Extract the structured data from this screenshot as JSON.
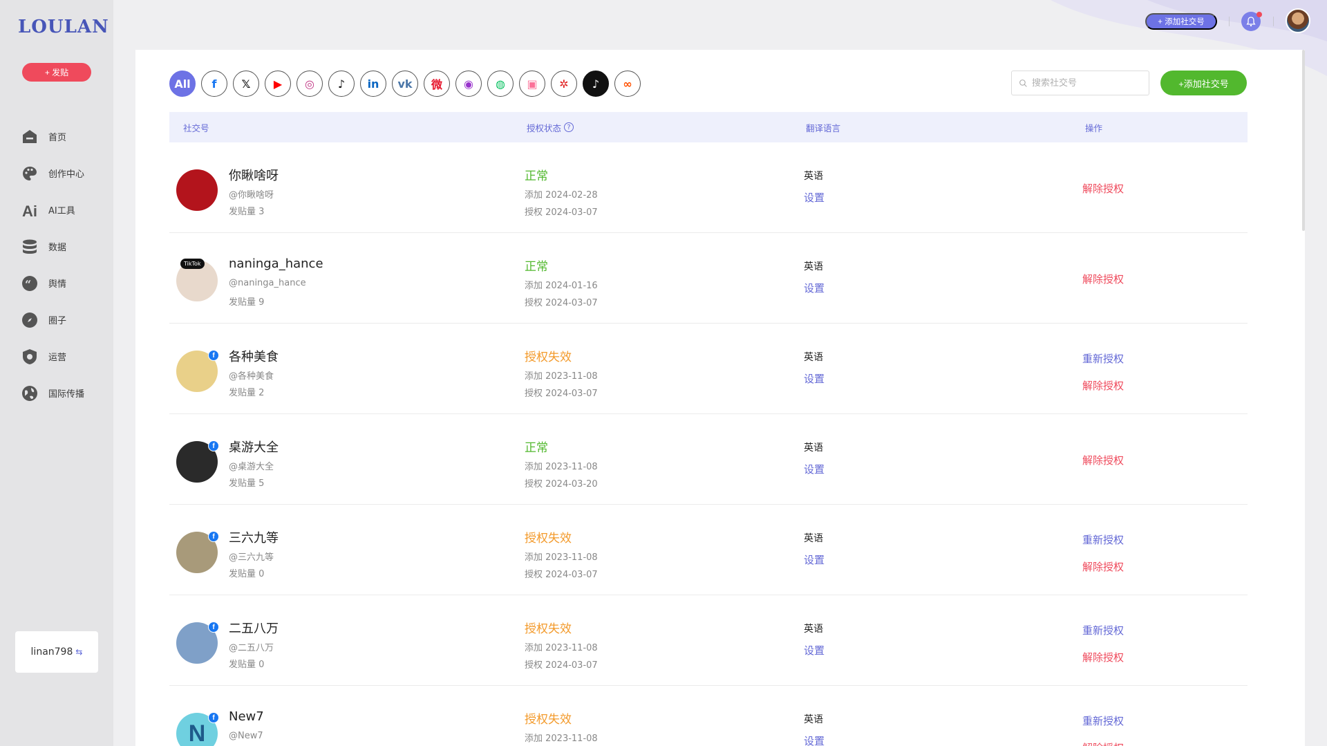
{
  "app": {
    "logo": "LOULAN",
    "post_button": "+ 发贴",
    "user": "linan798",
    "user_switch_icon": "⇆"
  },
  "sidebar": {
    "items": [
      {
        "label": "首页",
        "icon": "home-icon"
      },
      {
        "label": "创作中心",
        "icon": "palette-icon"
      },
      {
        "label": "AI工具",
        "icon": "ai-icon"
      },
      {
        "label": "数据",
        "icon": "database-icon"
      },
      {
        "label": "舆情",
        "icon": "quote-icon"
      },
      {
        "label": "圈子",
        "icon": "compass-icon"
      },
      {
        "label": "运营",
        "icon": "shield-icon"
      },
      {
        "label": "国际传播",
        "icon": "globe-icon"
      }
    ]
  },
  "topbar": {
    "add_social_label": "+ 添加社交号"
  },
  "platforms": [
    {
      "name": "all",
      "label": "All"
    },
    {
      "name": "facebook",
      "label": "f",
      "color": "#1877f2"
    },
    {
      "name": "x",
      "label": "𝕏",
      "color": "#111111"
    },
    {
      "name": "youtube",
      "label": "▶",
      "color": "#ff0000"
    },
    {
      "name": "instagram",
      "label": "◎",
      "color": "#c13584"
    },
    {
      "name": "tiktok",
      "label": "♪",
      "color": "#111111"
    },
    {
      "name": "linkedin",
      "label": "in",
      "color": "#0a66c2"
    },
    {
      "name": "vk",
      "label": "vk",
      "color": "#4a76a8"
    },
    {
      "name": "weibo",
      "label": "微",
      "color": "#e6162d"
    },
    {
      "name": "podcast",
      "label": "◉",
      "color": "#9933cc"
    },
    {
      "name": "wechat",
      "label": "◍",
      "color": "#07c160"
    },
    {
      "name": "bilibili",
      "label": "▣",
      "color": "#fb7299"
    },
    {
      "name": "kuaishou-dots",
      "label": "✲",
      "color": "#e02020"
    },
    {
      "name": "douyin",
      "label": "♪",
      "color": "#ffffff"
    },
    {
      "name": "kuaishou",
      "label": "∞",
      "color": "#ff5000"
    }
  ],
  "search": {
    "placeholder": "搜索社交号"
  },
  "add_button": "+添加社交号",
  "table": {
    "headers": {
      "account": "社交号",
      "auth_status": "授权状态",
      "translate_lang": "翻译语言",
      "action": "操作"
    },
    "rows": [
      {
        "name": "你瞅啥呀",
        "handle": "@你瞅啥呀",
        "posts": "发贴量 3",
        "status": "正常",
        "status_type": "ok",
        "added": "添加 2024-02-28",
        "authorized": "授权 2024-03-07",
        "lang": "英语",
        "setting": "设置",
        "reauth": "",
        "revoke": "解除授权",
        "badge": "none",
        "avatar_color": "#b3141c"
      },
      {
        "name": "naninga_hance",
        "handle": "@naninga_hance",
        "posts": "发贴量 9",
        "status": "正常",
        "status_type": "ok",
        "added": "添加 2024-01-16",
        "authorized": "授权 2024-03-07",
        "lang": "英语",
        "setting": "设置",
        "reauth": "",
        "revoke": "解除授权",
        "badge": "tiktok",
        "badge_text": "TikTok",
        "avatar_color": "#e8d9cc"
      },
      {
        "name": "各种美食",
        "handle": "@各种美食",
        "posts": "发贴量 2",
        "status": "授权失效",
        "status_type": "bad",
        "added": "添加 2023-11-08",
        "authorized": "授权 2024-03-07",
        "lang": "英语",
        "setting": "设置",
        "reauth": "重新授权",
        "revoke": "解除授权",
        "badge": "facebook",
        "badge_text": "f",
        "avatar_color": "#e9d089"
      },
      {
        "name": "桌游大全",
        "handle": "@桌游大全",
        "posts": "发贴量 5",
        "status": "正常",
        "status_type": "ok",
        "added": "添加 2023-11-08",
        "authorized": "授权 2024-03-20",
        "lang": "英语",
        "setting": "设置",
        "reauth": "",
        "revoke": "解除授权",
        "badge": "facebook",
        "badge_text": "f",
        "avatar_color": "#2a2a2a"
      },
      {
        "name": "三六九等",
        "handle": "@三六九等",
        "posts": "发贴量 0",
        "status": "授权失效",
        "status_type": "bad",
        "added": "添加 2023-11-08",
        "authorized": "授权 2024-03-07",
        "lang": "英语",
        "setting": "设置",
        "reauth": "重新授权",
        "revoke": "解除授权",
        "badge": "facebook",
        "badge_text": "f",
        "avatar_color": "#a89a7a"
      },
      {
        "name": "二五八万",
        "handle": "@二五八万",
        "posts": "发贴量 0",
        "status": "授权失效",
        "status_type": "bad",
        "added": "添加 2023-11-08",
        "authorized": "授权 2024-03-07",
        "lang": "英语",
        "setting": "设置",
        "reauth": "重新授权",
        "revoke": "解除授权",
        "badge": "facebook",
        "badge_text": "f",
        "avatar_color": "#7fa0c8"
      },
      {
        "name": "New7",
        "handle": "@New7",
        "posts": "",
        "status": "授权失效",
        "status_type": "bad",
        "added": "添加 2023-11-08",
        "authorized": "",
        "lang": "英语",
        "setting": "设置",
        "reauth": "重新授权",
        "revoke": "解除授权",
        "badge": "facebook",
        "badge_text": "f",
        "avatar_letter": "N",
        "avatar_color": "#6fd0e0"
      }
    ]
  }
}
